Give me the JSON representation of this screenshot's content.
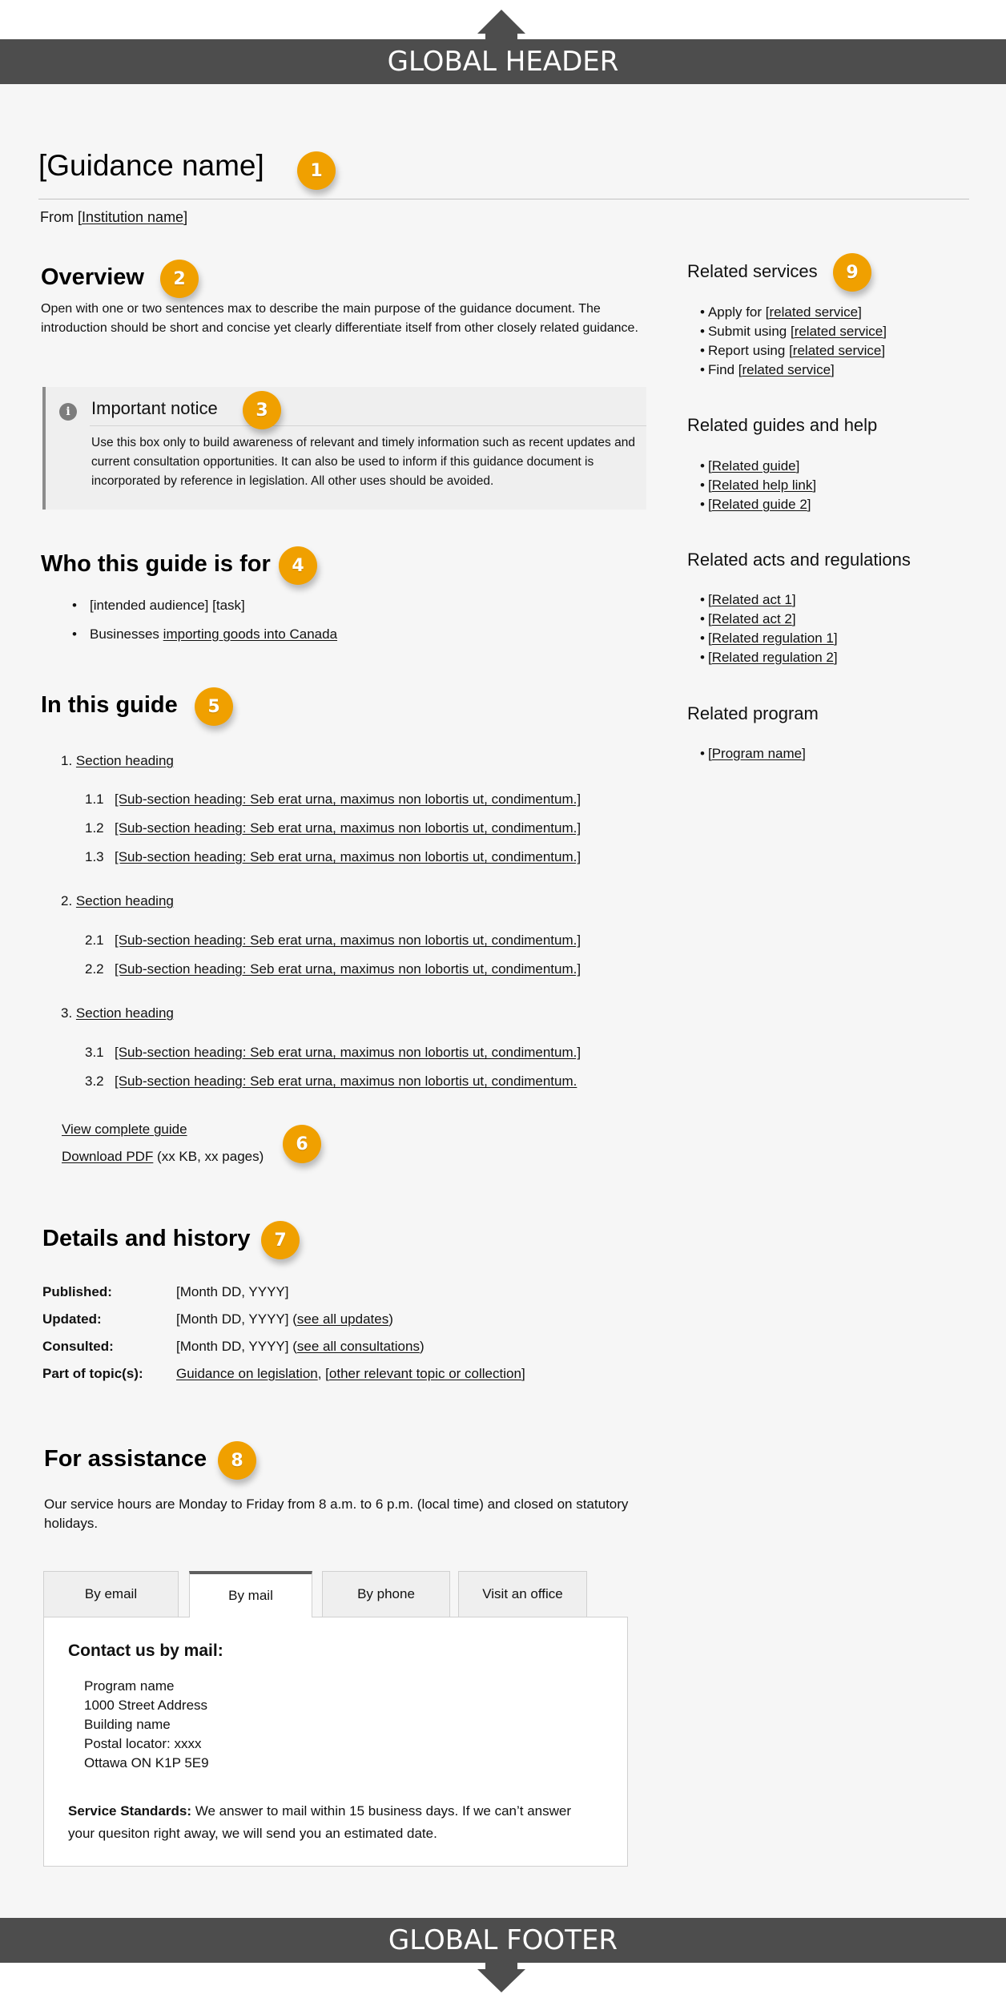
{
  "global_header": {
    "label": "GLOBAL HEADER"
  },
  "global_footer": {
    "label": "GLOBAL FOOTER"
  },
  "colors": {
    "badge": "#f0a000",
    "bar": "#4d4d4d",
    "page_bg": "#f6f6f6"
  },
  "badges": [
    "1",
    "2",
    "3",
    "4",
    "5",
    "6",
    "7",
    "8",
    "9"
  ],
  "title": "[Guidance name]",
  "from": {
    "prefix": "From [",
    "link": "Institution name",
    "suffix": "]"
  },
  "overview": {
    "heading": "Overview",
    "text": "Open with one or two sentences max to describe the main purpose of the guidance document. The introduction should be short and concise yet clearly differentiate itself from other closely related guidance."
  },
  "notice": {
    "icon": "info-icon",
    "icon_glyph": "i",
    "title": "Important notice",
    "text": "Use this box only to build awareness of relevant and timely information such as recent updates and current consultation opportunities. It can also be used to inform if this guidance document is incorporated by reference in legislation. All other uses should be avoided."
  },
  "audience": {
    "heading": "Who this guide is for",
    "items": [
      {
        "text": "[intended audience] [task]",
        "link": ""
      },
      {
        "text": "Businesses ",
        "link": "importing goods into Canada"
      }
    ]
  },
  "toc": {
    "heading": "In this guide",
    "sections": [
      {
        "num": "1.",
        "label": "Section heading",
        "subs": [
          {
            "num": "1.1",
            "label": "[Sub-section heading: Seb erat urna, maximus non lobortis ut, condimentum.]"
          },
          {
            "num": "1.2",
            "label": "[Sub-section heading: Seb erat urna, maximus non lobortis ut, condimentum.]"
          },
          {
            "num": "1.3",
            "label": "[Sub-section heading: Seb erat urna, maximus non lobortis ut, condimentum.]"
          }
        ]
      },
      {
        "num": "2.",
        "label": "Section heading",
        "subs": [
          {
            "num": "2.1",
            "label": "[Sub-section heading: Seb erat urna, maximus non lobortis ut, condimentum.]"
          },
          {
            "num": "2.2",
            "label": "[Sub-section heading: Seb erat urna, maximus non lobortis ut, condimentum.]"
          }
        ]
      },
      {
        "num": "3.",
        "label": "Section heading",
        "subs": [
          {
            "num": "3.1",
            "label": "[Sub-section heading: Seb erat urna, maximus non lobortis ut, condimentum.]"
          },
          {
            "num": "3.2",
            "label": "[Sub-section heading: Seb erat urna, maximus non lobortis ut, condimentum."
          }
        ]
      }
    ],
    "view_complete": "View complete guide",
    "download_pdf": "Download PDF",
    "pdf_meta": " (xx KB, xx pages)"
  },
  "details": {
    "heading": "Details and history",
    "rows": [
      {
        "label": "Published:",
        "value": "[Month DD, YYYY]",
        "pre": "",
        "link": "",
        "post": "",
        "link2": "",
        "post2": ""
      },
      {
        "label": "Updated:",
        "value": "[Month DD, YYYY] (",
        "link": "see all updates",
        "post": ")",
        "link2": "",
        "post2": ""
      },
      {
        "label": "Consulted:",
        "value": "[Month DD, YYYY] (",
        "link": "see all consultations",
        "post": ")",
        "link2": "",
        "post2": ""
      },
      {
        "label": "Part of topic(s):",
        "value": "",
        "link": "Guidance on legislation",
        "post": ", [",
        "link2": "other relevant topic or collection",
        "post2": "]"
      }
    ]
  },
  "assistance": {
    "heading": "For assistance",
    "text": "Our service hours are Monday to Friday from 8 a.m. to 6 p.m.  (local time) and closed on statutory holidays.",
    "tabs": [
      {
        "label": "By email",
        "active": false
      },
      {
        "label": "By mail",
        "active": true
      },
      {
        "label": "By phone",
        "active": false
      },
      {
        "label": "Visit an office",
        "active": false
      }
    ],
    "panel": {
      "heading": "Contact us by mail:",
      "address": [
        "Program name",
        "1000 Street Address",
        "Building name",
        "Postal locator: xxxx",
        "Ottawa ON  K1P 5E9"
      ],
      "standards_label": "Service Standards:",
      "standards_text": " We answer to mail within 15 business days. If we can’t answer your quesiton right away, we will send you an estimated date."
    }
  },
  "sidebar": {
    "groups": [
      {
        "heading": "Related services",
        "items": [
          {
            "prefix": "Apply for [",
            "link": "related service",
            "suffix": "]"
          },
          {
            "prefix": "Submit using [",
            "link": "related service",
            "suffix": "]"
          },
          {
            "prefix": "Report using [",
            "link": "related service",
            "suffix": "]"
          },
          {
            "prefix": "Find [",
            "link": "related service",
            "suffix": "]"
          }
        ]
      },
      {
        "heading": "Related guides and help",
        "items": [
          {
            "prefix": "[",
            "link": "Related guide",
            "suffix": "]"
          },
          {
            "prefix": "[",
            "link": "Related help link",
            "suffix": "]"
          },
          {
            "prefix": "[",
            "link": "Related guide 2",
            "suffix": "]"
          }
        ]
      },
      {
        "heading": "Related acts and regulations",
        "items": [
          {
            "prefix": "[",
            "link": "Related act 1",
            "suffix": "]"
          },
          {
            "prefix": "[",
            "link": "Related act 2",
            "suffix": "]"
          },
          {
            "prefix": "[",
            "link": "Related regulation 1",
            "suffix": "]"
          },
          {
            "prefix": "[",
            "link": "Related regulation 2",
            "suffix": "]"
          }
        ]
      },
      {
        "heading": "Related program",
        "items": [
          {
            "prefix": "[",
            "link": "Program name",
            "suffix": "]"
          }
        ]
      }
    ]
  }
}
